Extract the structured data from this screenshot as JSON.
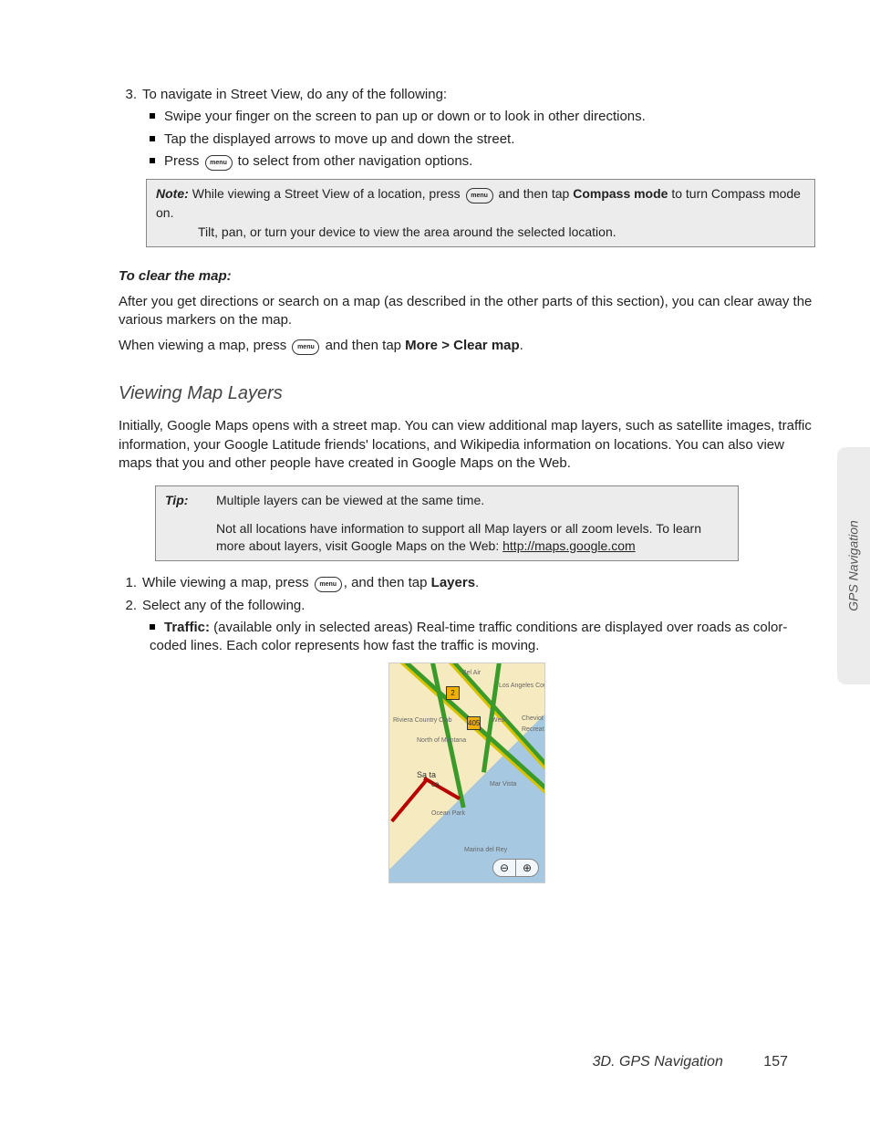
{
  "sideTab": "GPS Navigation",
  "footer": {
    "section": "3D. GPS Navigation",
    "page": "157"
  },
  "sv": {
    "step3num": "3.",
    "step3": "To navigate in Street View, do any of the following:",
    "b1": "Swipe your finger on the screen to pan up or down or to look in other directions.",
    "b2": "Tap the displayed arrows to move up and down the street.",
    "b3a": "Press ",
    "b3b": " to select from other navigation options."
  },
  "icon": {
    "menu": "menu"
  },
  "noteBox": {
    "label": "Note:",
    "l1a": "While viewing a Street View of a location, press ",
    "l1b": " and then tap ",
    "compass": "Compass mode",
    "l1c": " to turn Compass mode on.",
    "l2": "Tilt, pan, or turn your device to view the area around the selected location."
  },
  "clear": {
    "heading": "To clear the map:",
    "p1": "After you get directions or search on a map (as described in the other parts of this section), you can clear away the various markers on the map.",
    "p2a": "When viewing a map, press ",
    "p2b": " and then tap ",
    "more": "More",
    "gt": ">",
    "clearmap": "Clear map",
    "period": "."
  },
  "layers": {
    "heading": "Viewing Map Layers",
    "intro": "Initially, Google Maps opens with a street map. You can view additional map layers, such as satellite images, traffic information, your Google Latitude friends' locations, and Wikipedia information on locations. You can also view maps that you and other people have created in Google Maps on the Web.",
    "tipLabel": "Tip:",
    "tipRow1": "Multiple layers can be viewed at the same time.",
    "tipRow2a": "Not all locations have information to support all Map layers or all zoom levels. To learn more about layers, visit Google Maps on the Web: ",
    "tipRow2Link": "http://maps.google.com",
    "step1num": "1.",
    "step1a": "While viewing a map, press ",
    "step1b": ", and then tap ",
    "layersWord": "Layers",
    "step1c": ".",
    "step2num": "2.",
    "step2": "Select any of the following.",
    "b1label": "Traffic:",
    "b1text": " (available only in selected areas) Real-time traffic conditions are displayed over roads as color-coded lines. Each color represents how fast the traffic is moving."
  },
  "map": {
    "labels": [
      "Bel Air",
      "Los Angeles Country Club",
      "West",
      "Cheviot",
      "Recreatio",
      "Riviera Country Club",
      "North of Montana",
      "Mar Vista",
      "Sa  ta",
      "ca",
      "Ocean Park",
      "Marina del Rey"
    ],
    "shields": [
      "2",
      "405"
    ],
    "zoomOut": "⊖",
    "zoomIn": "⊕"
  }
}
